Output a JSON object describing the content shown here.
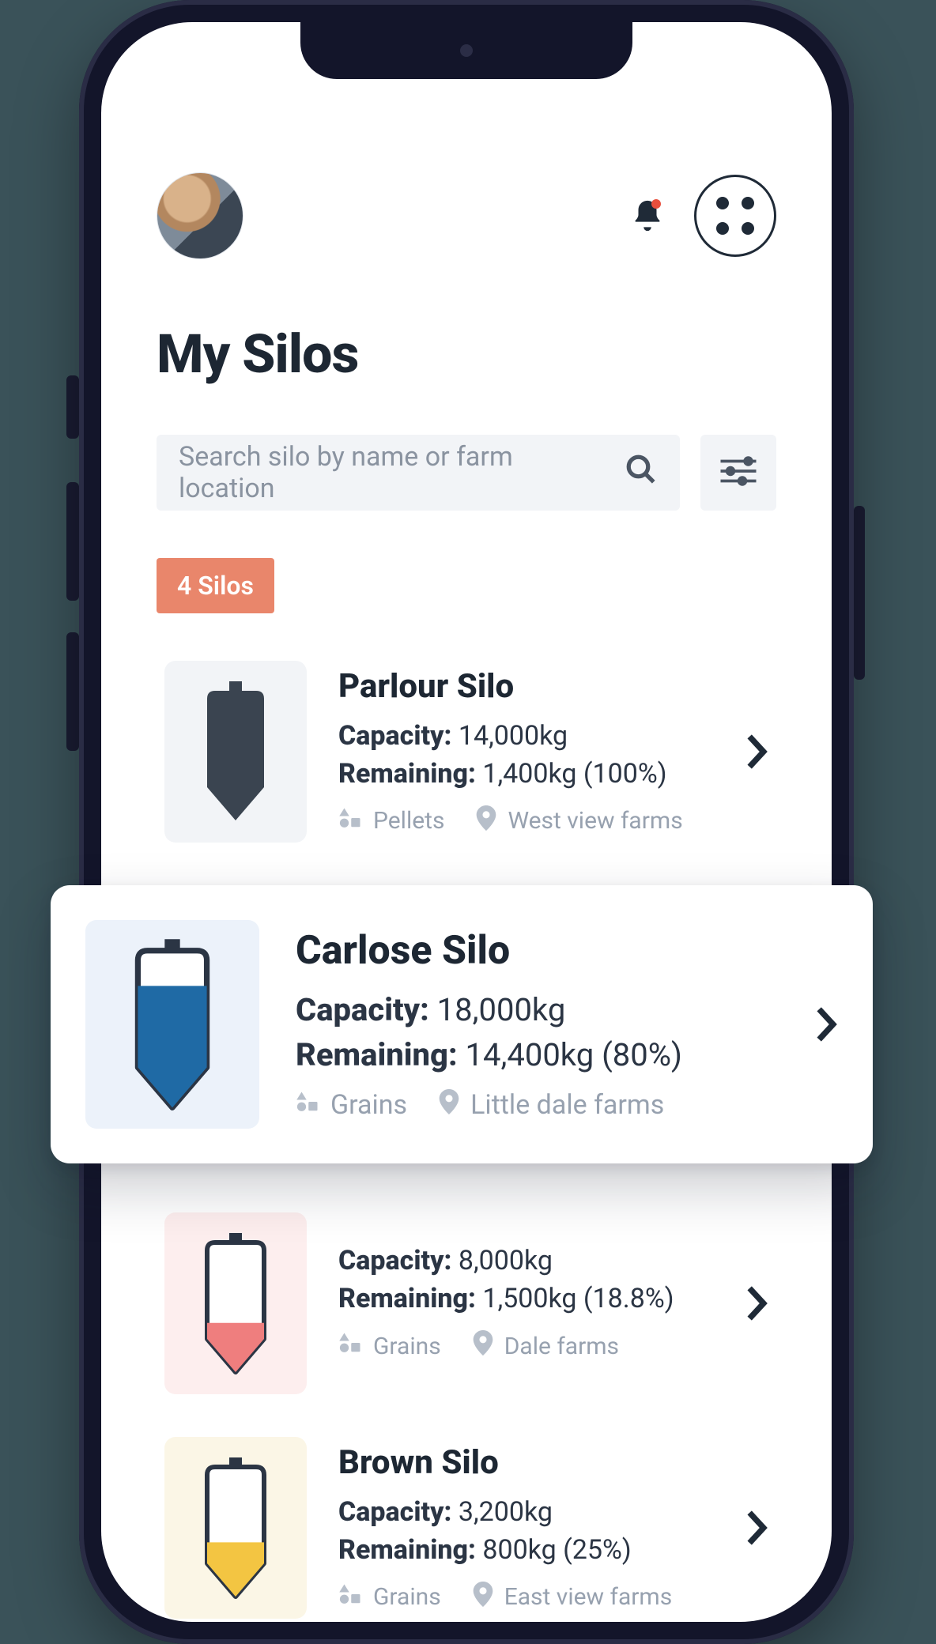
{
  "header": {
    "title": "My Silos"
  },
  "search": {
    "placeholder": "Search silo by name or farm location"
  },
  "count_badge": "4 Silos",
  "labels": {
    "capacity": "Capacity:",
    "remaining": "Remaining:"
  },
  "silos": [
    {
      "name": "Parlour Silo",
      "capacity": "14,000kg",
      "remaining": "1,400kg (100%)",
      "feed": "Pellets",
      "location": "West view farms",
      "fill_color": "#3a4450",
      "fill_pct": 100,
      "thumb": "t-gray"
    },
    {
      "name": "Carlose Silo",
      "capacity": "18,000kg",
      "remaining": "14,400kg (80%)",
      "feed": "Grains",
      "location": "Little dale farms",
      "fill_color": "#1f6aa5",
      "fill_pct": 80,
      "thumb": "t-blue",
      "popout": true
    },
    {
      "name": "",
      "capacity": "8,000kg",
      "remaining": "1,500kg (18.8%)",
      "feed": "Grains",
      "location": "Dale farms",
      "fill_color": "#ef7e7e",
      "fill_pct": 19,
      "thumb": "t-pink"
    },
    {
      "name": "Brown Silo",
      "capacity": "3,200kg",
      "remaining": "800kg (25%)",
      "feed": "Grains",
      "location": "East view farms",
      "fill_color": "#f3c542",
      "fill_pct": 25,
      "thumb": "t-yellow"
    }
  ]
}
